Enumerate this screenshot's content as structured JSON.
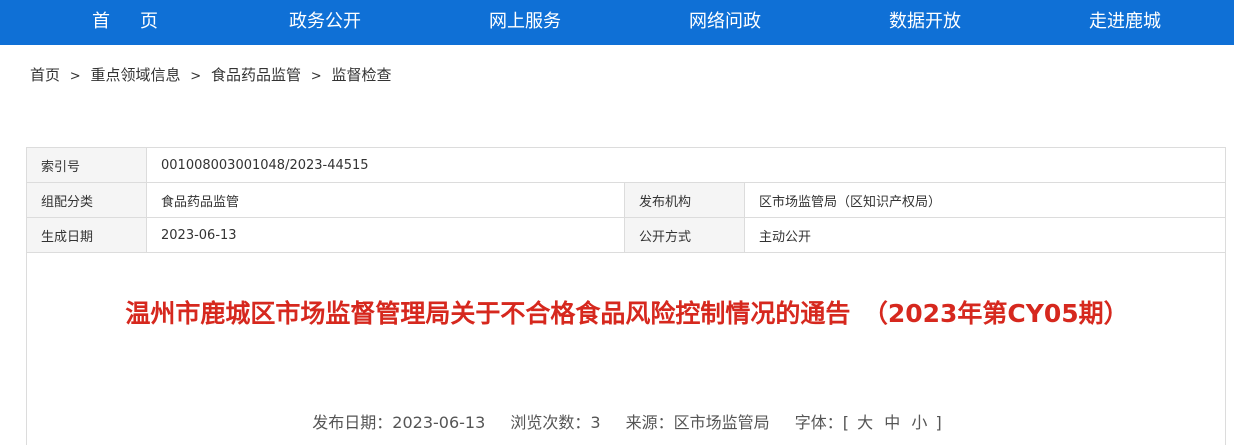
{
  "nav": {
    "items": [
      "首页",
      "政务公开",
      "网上服务",
      "网络问政",
      "数据开放",
      "走进鹿城"
    ]
  },
  "breadcrumb": {
    "items": [
      "首页",
      "重点领域信息",
      "食品药品监管",
      "监督检查"
    ],
    "separator": ">"
  },
  "meta": {
    "index_label": "索引号",
    "index_value": "001008003001048/2023-44515",
    "category_label": "组配分类",
    "category_value": "食品药品监管",
    "publisher_label": "发布机构",
    "publisher_value": "区市场监管局（区知识产权局）",
    "date_label": "生成日期",
    "date_value": "2023-06-13",
    "mode_label": "公开方式",
    "mode_value": "主动公开"
  },
  "article": {
    "title": "温州市鹿城区市场监督管理局关于不合格食品风险控制情况的通告　（2023年第CY05期）",
    "publish_date_label": "发布日期：",
    "publish_date": "2023-06-13",
    "views_label": "浏览次数：",
    "views": "3",
    "source_label": "来源：",
    "source": "区市场监管局",
    "font_label": "字体：",
    "font_open": "[",
    "font_large": "大",
    "font_medium": "中",
    "font_small": "小",
    "font_close": "]"
  },
  "colors": {
    "nav_bg": "#0f70d6",
    "title": "#d6281e"
  }
}
